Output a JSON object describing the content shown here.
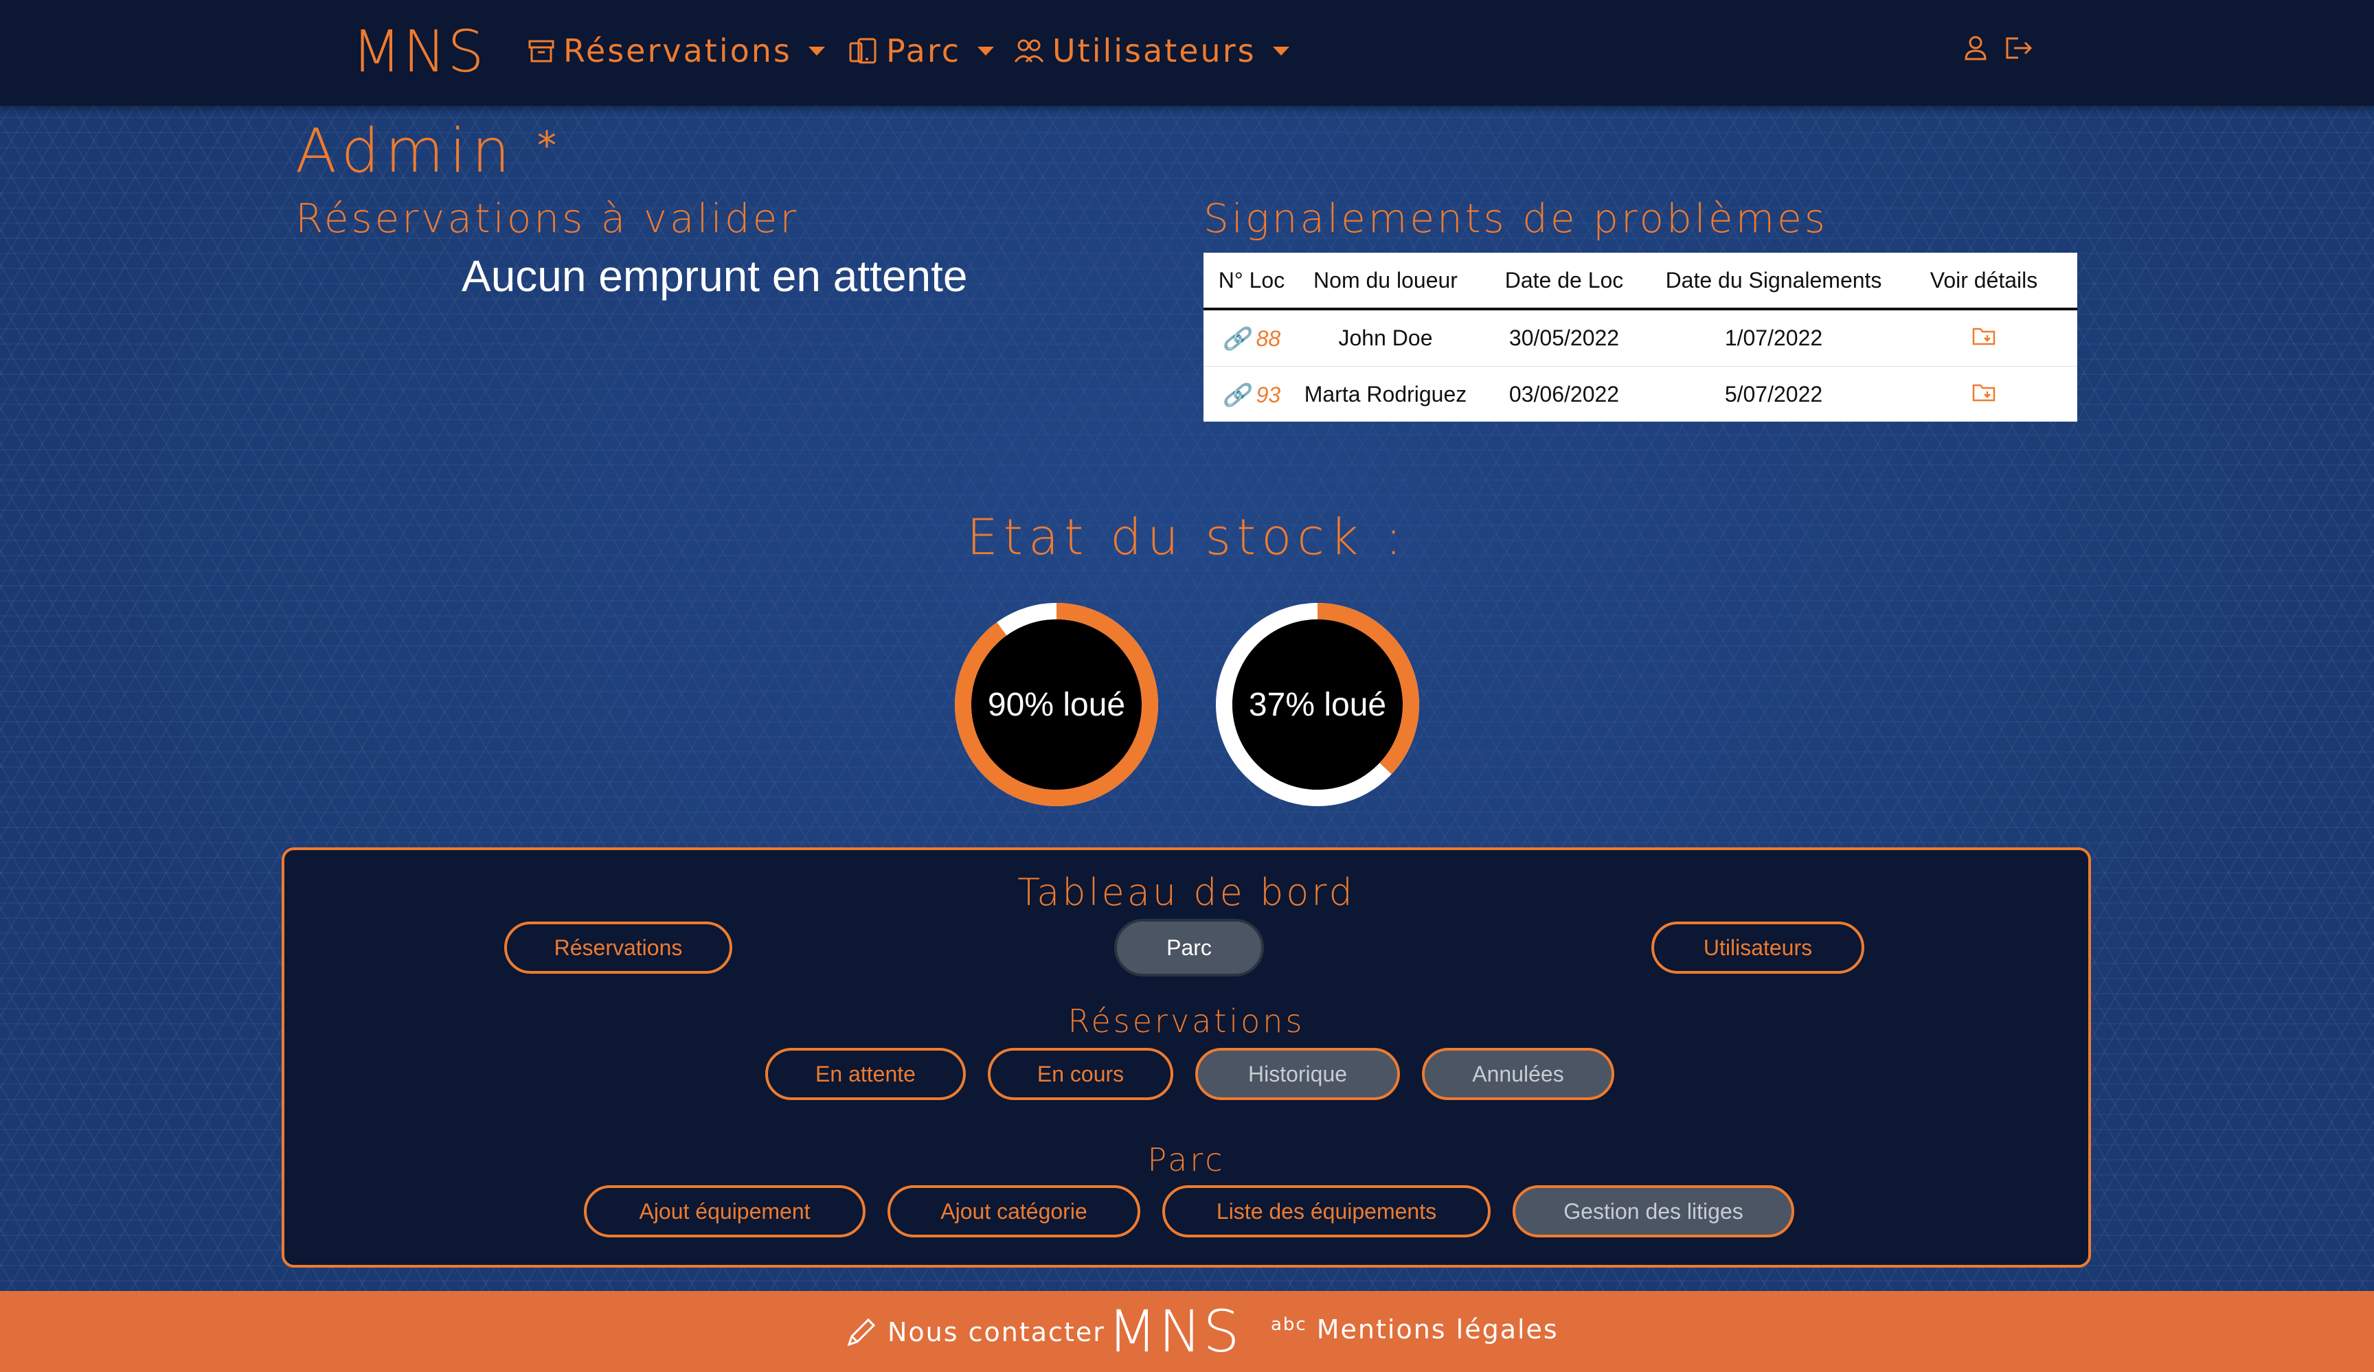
{
  "brand": {
    "logo_text": "MNS",
    "accent_color": "#ef7b2f",
    "navy": "#0b1733",
    "footer_color": "#e06f3c"
  },
  "navbar": {
    "items": [
      {
        "label": "Réservations",
        "icon": "archive-icon"
      },
      {
        "label": "Parc",
        "icon": "devices-icon"
      },
      {
        "label": "Utilisateurs",
        "icon": "users-icon"
      }
    ],
    "right_icons": [
      "user-icon",
      "logout-icon"
    ]
  },
  "page": {
    "title": "Admin",
    "title_marker": "*"
  },
  "pending_reservations": {
    "title": "Réservations à valider",
    "empty_message": "Aucun emprunt en attente"
  },
  "issues": {
    "title": "Signalements de problèmes",
    "columns": [
      "N° Loc",
      "Nom du loueur",
      "Date de Loc",
      "Date du Signalements",
      "Voir détails"
    ],
    "rows": [
      {
        "loc": "88",
        "name": "John Doe",
        "loc_date": "30/05/2022",
        "report_date": "1/07/2022",
        "details_icon": "folder-icon"
      },
      {
        "loc": "93",
        "name": "Marta Rodriguez",
        "loc_date": "03/06/2022",
        "report_date": "5/07/2022",
        "details_icon": "folder-icon"
      }
    ]
  },
  "stock": {
    "title": "Etat du stock :",
    "gauges": [
      {
        "label": "90% loué",
        "rented_fraction": 0.9
      },
      {
        "label": "37% loué",
        "rented_fraction": 0.37
      }
    ]
  },
  "dashboard": {
    "title": "Tableau de bord",
    "tabs": [
      "Réservations",
      "Parc",
      "Utilisateurs"
    ],
    "active_tab": "Parc",
    "reservations_heading": "Réservations",
    "reservations_buttons": [
      "En attente",
      "En cours",
      "Historique",
      "Annulées"
    ],
    "parc_heading": "Parc",
    "parc_buttons": [
      "Ajout équipement",
      "Ajout catégorie",
      "Liste des équipements",
      "Gestion des litiges"
    ]
  },
  "footer": {
    "contact": "Nous contacter",
    "logo_text": "MNS",
    "legal": "Mentions légales",
    "legal_icon_text": "abc"
  }
}
